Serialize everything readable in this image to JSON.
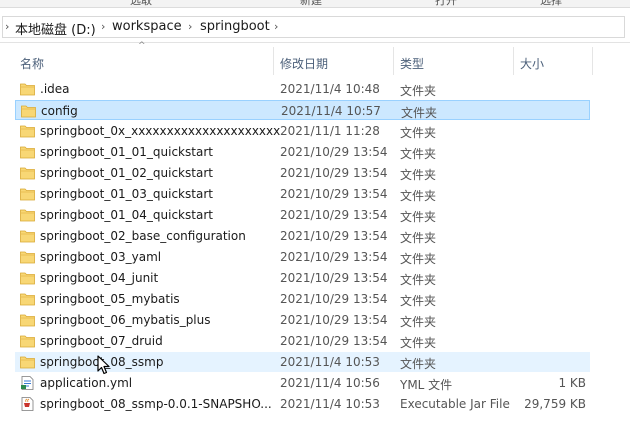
{
  "ribbon": {
    "items": [
      "选取",
      "新建",
      "打开",
      "选择"
    ]
  },
  "address": {
    "crumbs": [
      "本地磁盘 (D:)",
      "workspace",
      "springboot"
    ]
  },
  "columns": {
    "name": "名称",
    "date": "修改日期",
    "type": "类型",
    "size": "大小"
  },
  "rows": [
    {
      "name": ".idea",
      "date": "2021/11/4 10:48",
      "type": "文件夹",
      "size": "",
      "icon": "folder-icon",
      "state": ""
    },
    {
      "name": "config",
      "date": "2021/11/4 10:57",
      "type": "文件夹",
      "size": "",
      "icon": "folder-icon",
      "state": "selected"
    },
    {
      "name": "springboot_0x_xxxxxxxxxxxxxxxxxxxxx",
      "date": "2021/11/1 11:28",
      "type": "文件夹",
      "size": "",
      "icon": "folder-icon",
      "state": ""
    },
    {
      "name": "springboot_01_01_quickstart",
      "date": "2021/10/29 13:54",
      "type": "文件夹",
      "size": "",
      "icon": "folder-icon",
      "state": ""
    },
    {
      "name": "springboot_01_02_quickstart",
      "date": "2021/10/29 13:54",
      "type": "文件夹",
      "size": "",
      "icon": "folder-icon",
      "state": ""
    },
    {
      "name": "springboot_01_03_quickstart",
      "date": "2021/10/29 13:54",
      "type": "文件夹",
      "size": "",
      "icon": "folder-icon",
      "state": ""
    },
    {
      "name": "springboot_01_04_quickstart",
      "date": "2021/10/29 13:54",
      "type": "文件夹",
      "size": "",
      "icon": "folder-icon",
      "state": ""
    },
    {
      "name": "springboot_02_base_configuration",
      "date": "2021/10/29 13:54",
      "type": "文件夹",
      "size": "",
      "icon": "folder-icon",
      "state": ""
    },
    {
      "name": "springboot_03_yaml",
      "date": "2021/10/29 13:54",
      "type": "文件夹",
      "size": "",
      "icon": "folder-icon",
      "state": ""
    },
    {
      "name": "springboot_04_junit",
      "date": "2021/10/29 13:54",
      "type": "文件夹",
      "size": "",
      "icon": "folder-icon",
      "state": ""
    },
    {
      "name": "springboot_05_mybatis",
      "date": "2021/10/29 13:54",
      "type": "文件夹",
      "size": "",
      "icon": "folder-icon",
      "state": ""
    },
    {
      "name": "springboot_06_mybatis_plus",
      "date": "2021/10/29 13:54",
      "type": "文件夹",
      "size": "",
      "icon": "folder-icon",
      "state": ""
    },
    {
      "name": "springboot_07_druid",
      "date": "2021/10/29 13:54",
      "type": "文件夹",
      "size": "",
      "icon": "folder-icon",
      "state": ""
    },
    {
      "name": "springboot_08_ssmp",
      "date": "2021/11/4 10:53",
      "type": "文件夹",
      "size": "",
      "icon": "folder-icon",
      "state": "hover"
    },
    {
      "name": "application.yml",
      "date": "2021/11/4 10:56",
      "type": "YML 文件",
      "size": "1 KB",
      "icon": "yml-file-icon",
      "state": ""
    },
    {
      "name": "springboot_08_ssmp-0.0.1-SNAPSHO...",
      "date": "2021/11/4 10:53",
      "type": "Executable Jar File",
      "size": "29,759 KB",
      "icon": "jar-file-icon",
      "state": ""
    }
  ],
  "colors": {
    "selected_bg": "#cce8ff",
    "selected_border": "#99d1ff",
    "hover_bg": "#e5f3ff",
    "folder": "#f8d775",
    "header_text": "#4c607a"
  }
}
